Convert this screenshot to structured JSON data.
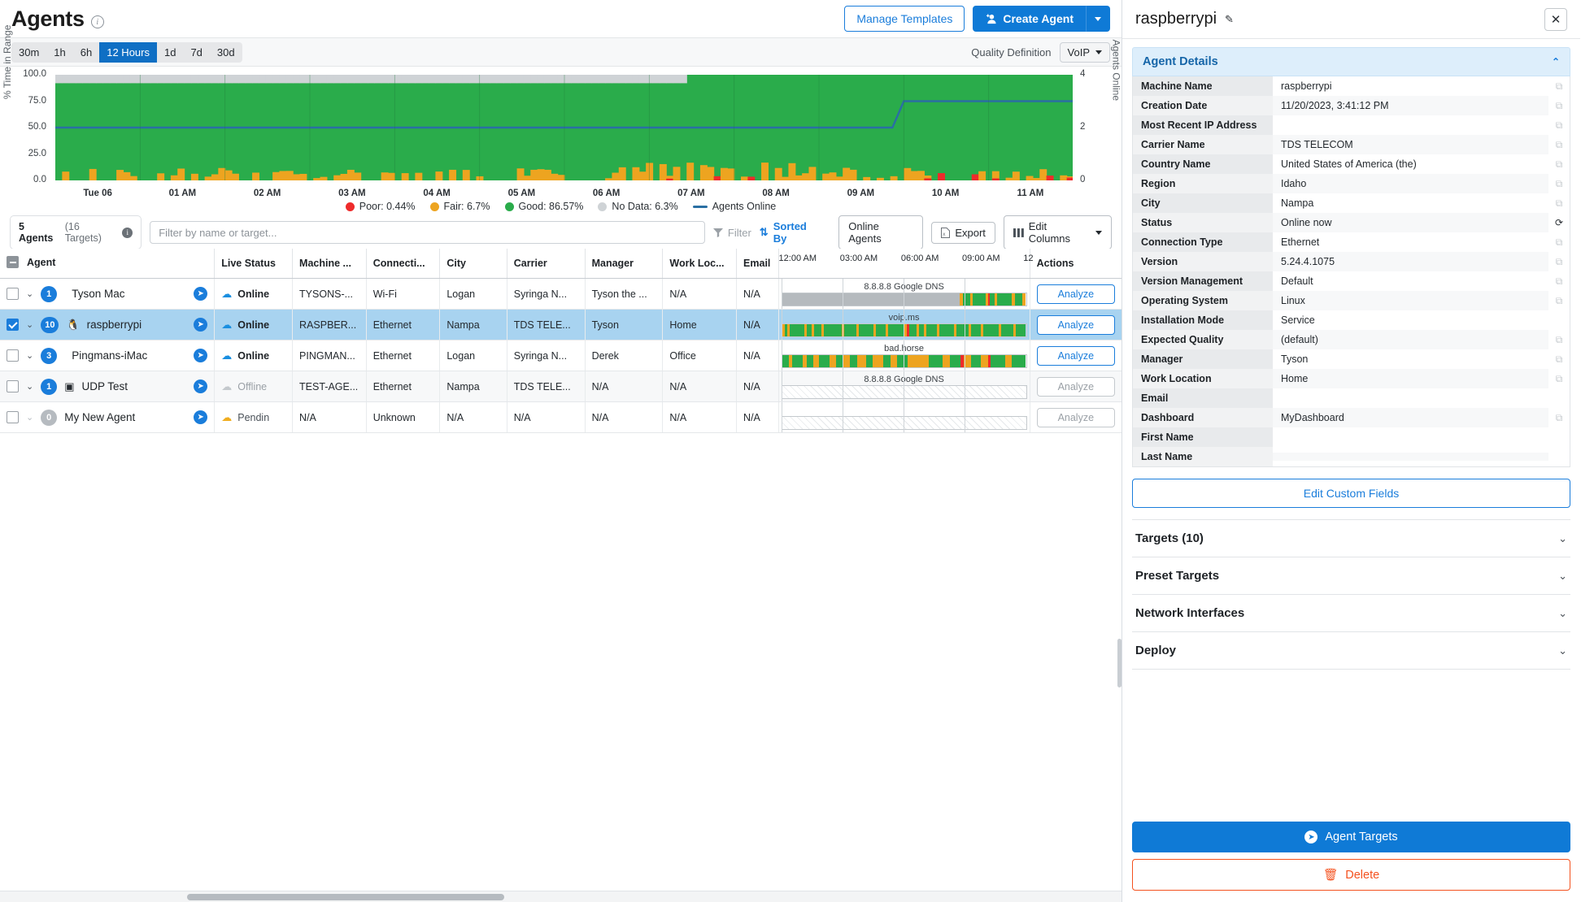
{
  "header": {
    "title": "Agents",
    "info_icon": "info-icon",
    "manage_templates": "Manage Templates",
    "create_agent": "Create Agent"
  },
  "rangebar": {
    "ranges": [
      "30m",
      "1h",
      "6h",
      "12 Hours",
      "1d",
      "7d",
      "30d"
    ],
    "active_index": 3,
    "quality_definition_label": "Quality Definition",
    "quality_definition_value": "VoIP"
  },
  "chart_data": {
    "type": "area",
    "title": "",
    "ylabel": "% Time in Range",
    "y2label": "Agents Online",
    "yticks": [
      "100.0",
      "75.0",
      "50.0",
      "25.0",
      "0.0"
    ],
    "ylim": [
      0,
      100
    ],
    "y2ticks": [
      "4",
      "2",
      "0"
    ],
    "y2lim": [
      0,
      4
    ],
    "xlabel": "",
    "xticks": [
      "Tue 06",
      "01 AM",
      "02 AM",
      "03 AM",
      "04 AM",
      "05 AM",
      "06 AM",
      "07 AM",
      "08 AM",
      "09 AM",
      "10 AM",
      "11 AM"
    ],
    "grid": false,
    "legend_position": "bottom",
    "series": [
      {
        "name": "Poor",
        "label": "Poor: 0.44%",
        "value": 0.44,
        "color": "#ee2b2b"
      },
      {
        "name": "Fair",
        "label": "Fair: 6.7%",
        "value": 6.7,
        "color": "#eda420"
      },
      {
        "name": "Good",
        "label": "Good: 86.57%",
        "value": 86.57,
        "color": "#2aac4b"
      },
      {
        "name": "No Data",
        "label": "No Data: 6.3%",
        "value": 6.3,
        "color": "#cfd3d6"
      },
      {
        "name": "Agents Online",
        "label": "Agents Online",
        "color": "#2a6fa3",
        "type": "line",
        "values": [
          2,
          2,
          2,
          2,
          2,
          2,
          2,
          2,
          2,
          2,
          3,
          3
        ]
      }
    ]
  },
  "tablebar": {
    "agents_count": "5 Agents",
    "targets_count": "(16 Targets)",
    "filter_placeholder": "Filter by name or target...",
    "filter_value": "",
    "filter_label": "Filter",
    "sorted_by_label": "Sorted By",
    "online_agents_label": "Online Agents",
    "export_label": "Export",
    "edit_columns_label": "Edit Columns"
  },
  "table": {
    "columns": [
      "Agent",
      "Live Status",
      "Machine ...",
      "Connecti...",
      "City",
      "Carrier",
      "Manager",
      "Work Loc...",
      "Email"
    ],
    "timeline_ticks": [
      "12:00 AM",
      "03:00 AM",
      "06:00 AM",
      "09:00 AM",
      "12"
    ],
    "actions_header": "Actions",
    "analyze_label": "Analyze",
    "rows": [
      {
        "selected": false,
        "count": "1",
        "os_icon": "apple-icon",
        "name": "Tyson Mac",
        "status": "Online",
        "status_kind": "online",
        "machine": "TYSONS-...",
        "connection": "Wi-Fi",
        "city": "Logan",
        "carrier": "Syringa N...",
        "manager": "Tyson the ...",
        "work_location": "N/A",
        "email": "N/A",
        "target_label": "8.8.8.8 Google DNS",
        "timeline_kind": "data",
        "timeline": [
          [
            "#b5babe",
            72
          ],
          [
            "#eda420",
            1.5
          ],
          [
            "#2aac4b",
            3
          ],
          [
            "#eda420",
            1
          ],
          [
            "#2aac4b",
            5
          ],
          [
            "#eda420",
            1
          ],
          [
            "#ee2b2b",
            0.8
          ],
          [
            "#2aac4b",
            2
          ],
          [
            "#eda420",
            1
          ],
          [
            "#2aac4b",
            6
          ],
          [
            "#eda420",
            1.2
          ],
          [
            "#2aac4b",
            3
          ],
          [
            "#eda420",
            1.5
          ]
        ],
        "analyze_enabled": true
      },
      {
        "selected": true,
        "count": "10",
        "os_icon": "linux-icon",
        "name": "raspberrypi",
        "status": "Online",
        "status_kind": "online",
        "machine": "RASPBER...",
        "connection": "Ethernet",
        "city": "Nampa",
        "carrier": "TDS TELE...",
        "manager": "Tyson",
        "work_location": "Home",
        "email": "N/A",
        "target_label": "voip.ms",
        "timeline_kind": "data",
        "timeline": [
          [
            "#eda420",
            1
          ],
          [
            "#2aac4b",
            1
          ],
          [
            "#eda420",
            1
          ],
          [
            "#2aac4b",
            6
          ],
          [
            "#eda420",
            1
          ],
          [
            "#2aac4b",
            2
          ],
          [
            "#eda420",
            1
          ],
          [
            "#2aac4b",
            3
          ],
          [
            "#eda420",
            1
          ],
          [
            "#2aac4b",
            7
          ],
          [
            "#eda420",
            1
          ],
          [
            "#2aac4b",
            5
          ],
          [
            "#eda420",
            1
          ],
          [
            "#2aac4b",
            6
          ],
          [
            "#eda420",
            1
          ],
          [
            "#2aac4b",
            4
          ],
          [
            "#eda420",
            1
          ],
          [
            "#2aac4b",
            6
          ],
          [
            "#eda420",
            1.5
          ],
          [
            "#ee2b2b",
            0.8
          ],
          [
            "#2aac4b",
            3
          ],
          [
            "#eda420",
            1
          ],
          [
            "#2aac4b",
            2
          ],
          [
            "#eda420",
            1.2
          ],
          [
            "#2aac4b",
            4
          ],
          [
            "#eda420",
            1
          ],
          [
            "#2aac4b",
            6
          ],
          [
            "#eda420",
            1
          ],
          [
            "#2aac4b",
            5
          ],
          [
            "#eda420",
            1
          ],
          [
            "#2aac4b",
            4
          ],
          [
            "#eda420",
            1
          ],
          [
            "#2aac4b",
            6
          ],
          [
            "#eda420",
            1
          ],
          [
            "#2aac4b",
            5
          ],
          [
            "#eda420",
            1
          ],
          [
            "#2aac4b",
            4
          ]
        ],
        "analyze_enabled": true
      },
      {
        "selected": false,
        "count": "3",
        "os_icon": "apple-icon",
        "name": "Pingmans-iMac",
        "status": "Online",
        "status_kind": "online",
        "machine": "PINGMAN...",
        "connection": "Ethernet",
        "city": "Logan",
        "carrier": "Syringa N...",
        "manager": "Derek",
        "work_location": "Office",
        "email": "N/A",
        "target_label": "bad.horse",
        "timeline_kind": "data",
        "timeline": [
          [
            "#2aac4b",
            2
          ],
          [
            "#eda420",
            1
          ],
          [
            "#2aac4b",
            3
          ],
          [
            "#eda420",
            1
          ],
          [
            "#2aac4b",
            2
          ],
          [
            "#eda420",
            1.5
          ],
          [
            "#2aac4b",
            3
          ],
          [
            "#eda420",
            2
          ],
          [
            "#2aac4b",
            2
          ],
          [
            "#eda420",
            2
          ],
          [
            "#2aac4b",
            2
          ],
          [
            "#eda420",
            2.5
          ],
          [
            "#2aac4b",
            2
          ],
          [
            "#eda420",
            3
          ],
          [
            "#2aac4b",
            2
          ],
          [
            "#eda420",
            2
          ],
          [
            "#2aac4b",
            3
          ],
          [
            "#eda420",
            6
          ],
          [
            "#2aac4b",
            4
          ],
          [
            "#eda420",
            2
          ],
          [
            "#2aac4b",
            3
          ],
          [
            "#ee2b2b",
            1
          ],
          [
            "#eda420",
            2
          ],
          [
            "#2aac4b",
            3
          ],
          [
            "#eda420",
            2
          ],
          [
            "#ee2b2b",
            0.8
          ],
          [
            "#2aac4b",
            4
          ],
          [
            "#eda420",
            2
          ],
          [
            "#2aac4b",
            4
          ]
        ],
        "analyze_enabled": true
      },
      {
        "selected": false,
        "count": "1",
        "os_icon": "windows-icon",
        "name": "UDP Test",
        "status": "Offline",
        "status_kind": "offline",
        "machine": "TEST-AGE...",
        "connection": "Ethernet",
        "city": "Nampa",
        "carrier": "TDS TELE...",
        "manager": "N/A",
        "work_location": "N/A",
        "email": "N/A",
        "target_label": "8.8.8.8 Google DNS",
        "timeline_kind": "empty",
        "timeline": [],
        "analyze_enabled": false
      },
      {
        "selected": false,
        "count": "0",
        "os_icon": "none",
        "name": "My New Agent",
        "status": "Pendin",
        "status_kind": "pending",
        "machine": "N/A",
        "connection": "Unknown",
        "city": "N/A",
        "carrier": "N/A",
        "manager": "N/A",
        "work_location": "N/A",
        "email": "N/A",
        "target_label": "",
        "timeline_kind": "empty",
        "timeline": [],
        "analyze_enabled": false
      }
    ]
  },
  "details": {
    "title": "raspberrypi",
    "edit_icon": "pencil-icon",
    "close_icon": "close-icon",
    "section_title": "Agent Details",
    "fields": [
      {
        "key": "Machine Name",
        "value": "raspberrypi",
        "copy": true
      },
      {
        "key": "Creation Date",
        "value": "11/20/2023, 3:41:12 PM",
        "copy": true
      },
      {
        "key": "Most Recent IP Address",
        "value": "",
        "copy": true
      },
      {
        "key": "Carrier Name",
        "value": "TDS TELECOM",
        "copy": true
      },
      {
        "key": "Country Name",
        "value": "United States of America (the)",
        "copy": true
      },
      {
        "key": "Region",
        "value": "Idaho",
        "copy": true
      },
      {
        "key": "City",
        "value": "Nampa",
        "copy": true
      },
      {
        "key": "Status",
        "value": "Online now",
        "copy": true,
        "icon": "refresh-icon"
      },
      {
        "key": "Connection Type",
        "value": "Ethernet",
        "copy": true
      },
      {
        "key": "Version",
        "value": "5.24.4.1075",
        "copy": true
      },
      {
        "key": "Version Management",
        "value": "Default",
        "copy": true
      },
      {
        "key": "Operating System",
        "value": "Linux",
        "copy": true
      },
      {
        "key": "Installation Mode",
        "value": "Service",
        "copy": false
      },
      {
        "key": "Expected Quality",
        "value": "(default)",
        "copy": true
      },
      {
        "key": "Manager",
        "value": "Tyson",
        "copy": true
      },
      {
        "key": "Work Location",
        "value": "Home",
        "copy": true
      },
      {
        "key": "Email",
        "value": "",
        "copy": false
      },
      {
        "key": "Dashboard",
        "value": "MyDashboard",
        "copy": true
      },
      {
        "key": "First Name",
        "value": "",
        "copy": false
      },
      {
        "key": "Last Name",
        "value": "",
        "copy": false
      }
    ],
    "edit_custom_fields": "Edit Custom Fields",
    "accordions": [
      "Targets (10)",
      "Preset Targets",
      "Network Interfaces",
      "Deploy"
    ],
    "agent_targets_button": "Agent Targets",
    "delete_button": "Delete"
  },
  "colors": {
    "primary": "#0f7ad6",
    "link": "#1a7ddb",
    "good": "#2aac4b",
    "fair": "#eda420",
    "poor": "#ee2b2b",
    "nodata": "#cfd3d6",
    "line": "#2a6fa3",
    "danger": "#f4511e",
    "selected_row": "#a8d3f0"
  }
}
